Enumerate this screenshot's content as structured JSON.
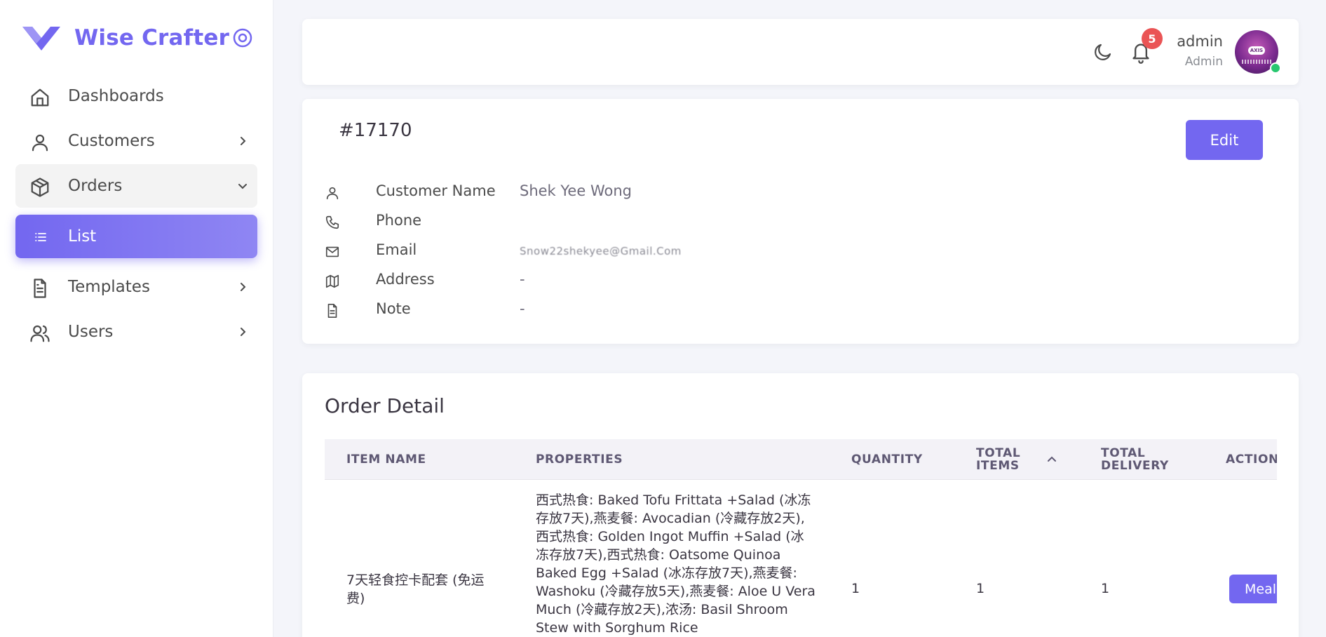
{
  "brand": {
    "name": "Wise Crafter"
  },
  "sidebar": {
    "items": [
      {
        "label": "Dashboards",
        "icon": "home-icon"
      },
      {
        "label": "Customers",
        "icon": "user-icon"
      },
      {
        "label": "Orders",
        "icon": "box-icon"
      },
      {
        "label": "List",
        "icon": "list-icon"
      },
      {
        "label": "Templates",
        "icon": "file-text-icon"
      },
      {
        "label": "Users",
        "icon": "users-icon"
      }
    ]
  },
  "header": {
    "notification_count": "5",
    "user_name": "admin",
    "user_role": "Admin",
    "avatar_text": "AXIS"
  },
  "order": {
    "id": "#17170",
    "edit_label": "Edit",
    "fields": {
      "customer_name_label": "Customer Name",
      "customer_name": "Shek Yee Wong",
      "phone_label": "Phone",
      "phone": "",
      "email_label": "Email",
      "email": "Snow22shekyee@Gmail.Com",
      "address_label": "Address",
      "address": "-",
      "note_label": "Note",
      "note": "-"
    }
  },
  "detail": {
    "title": "Order Detail",
    "columns": [
      "ITEM NAME",
      "PROPERTIES",
      "QUANTITY",
      "TOTAL ITEMS",
      "TOTAL DELIVERY",
      "ACTION"
    ],
    "rows": [
      {
        "item_name": "7天轻食控卡配套 (免运费)",
        "properties": "西式热食: Baked Tofu Frittata +Salad (冰冻存放7天),燕麦餐: Avocadian (冷藏存放2天),西式热食: Golden Ingot Muffin +Salad (冰冻存放7天),西式热食: Oatsome Quinoa Baked Egg +Salad (冰冻存放7天),燕麦餐: Washoku (冷藏存放5天),燕麦餐: Aloe U Vera Much (冷藏存放2天),浓汤: Basil Shroom Stew with Sorghum Rice",
        "quantity": "1",
        "total_items": "1",
        "total_delivery": "1",
        "action_label": "Meal"
      }
    ]
  },
  "colors": {
    "primary": "#7367f0",
    "danger": "#ea5455",
    "success": "#28c76f"
  }
}
